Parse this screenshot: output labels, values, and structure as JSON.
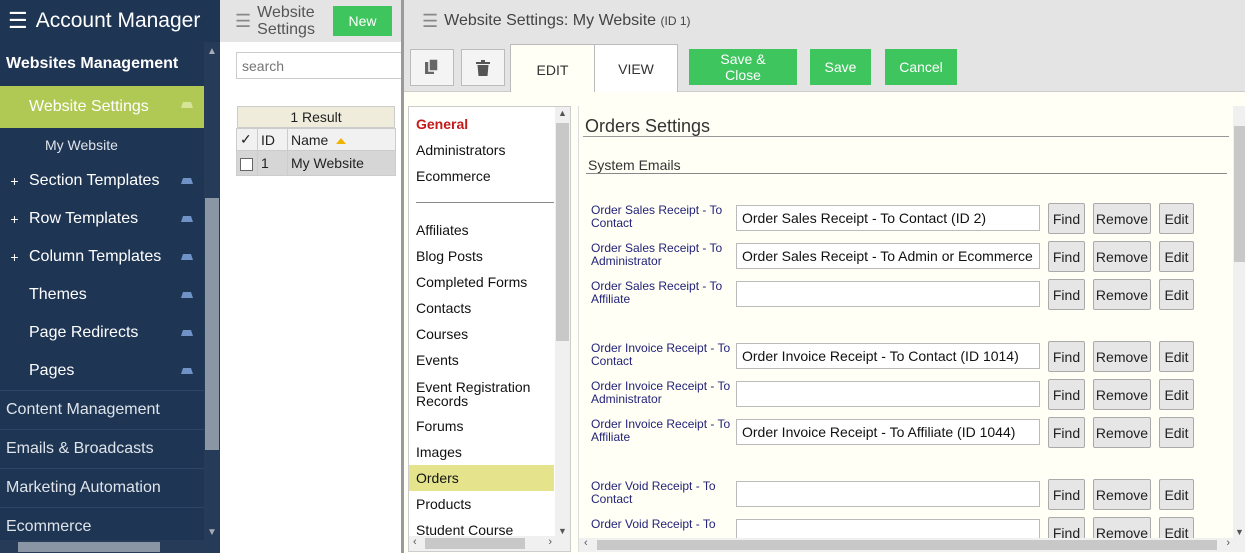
{
  "nav": {
    "app_title": "Account Manager",
    "section_title": "Websites Management",
    "active_item": "Website Settings",
    "sub_item": "My Website",
    "items": [
      {
        "label": "Section Templates",
        "expandable": true
      },
      {
        "label": "Row Templates",
        "expandable": true
      },
      {
        "label": "Column Templates",
        "expandable": true
      },
      {
        "label": "Themes",
        "expandable": false
      },
      {
        "label": "Page Redirects",
        "expandable": false
      },
      {
        "label": "Pages",
        "expandable": false
      }
    ],
    "groups": [
      "Content Management",
      "Emails & Broadcasts",
      "Marketing Automation",
      "Ecommerce"
    ],
    "expand_symbol": "+",
    "accent_color": "#b0c954",
    "bg_color": "#1e3553"
  },
  "list": {
    "title": "Website Settings",
    "new_label": "New",
    "search_placeholder": "search",
    "result_count": "1 Result",
    "columns": {
      "check": "✓",
      "id": "ID",
      "name": "Name"
    },
    "rows": [
      {
        "id": "1",
        "name": "My Website"
      }
    ]
  },
  "main": {
    "title": "Website Settings: My Website",
    "title_id": "(ID 1)",
    "tabs": {
      "edit": "EDIT",
      "view": "VIEW"
    },
    "buttons": {
      "save_close": "Save & Close",
      "save": "Save",
      "cancel": "Cancel"
    },
    "icons": {
      "copy": "copy-icon",
      "delete": "trash-icon"
    }
  },
  "categories": {
    "general": "General",
    "top": [
      "Administrators",
      "Ecommerce"
    ],
    "items": [
      "Affiliates",
      "Blog Posts",
      "Completed Forms",
      "Contacts",
      "Courses",
      "Events",
      "Event Registration Records",
      "Forums",
      "Images",
      "Orders",
      "Products",
      "Student Course"
    ],
    "selected": "Orders"
  },
  "settings": {
    "heading": "Orders Settings",
    "subheading": "System Emails",
    "button_labels": {
      "find": "Find",
      "remove": "Remove",
      "edit": "Edit"
    },
    "rows": [
      {
        "label": "Order Sales Receipt - To Contact",
        "value": "Order Sales Receipt - To Contact (ID 2)"
      },
      {
        "label": "Order Sales Receipt - To Administrator",
        "value": "Order Sales Receipt - To Admin or Ecommerce"
      },
      {
        "label": "Order Sales Receipt - To Affiliate",
        "value": ""
      },
      {
        "label": "Order Invoice Receipt - To Contact",
        "value": "Order Invoice Receipt - To Contact (ID 1014)"
      },
      {
        "label": "Order Invoice Receipt - To Administrator",
        "value": ""
      },
      {
        "label": "Order Invoice Receipt - To Affiliate",
        "value": "Order Invoice Receipt - To Affiliate (ID 1044)"
      },
      {
        "label": "Order Void Receipt - To Contact",
        "value": ""
      },
      {
        "label": "Order Void Receipt - To",
        "value": ""
      }
    ]
  }
}
